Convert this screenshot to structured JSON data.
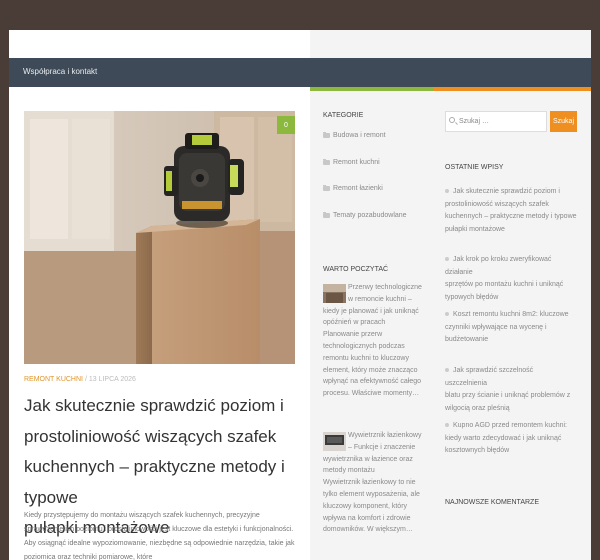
{
  "nav": {
    "item": "Współpraca i kontakt"
  },
  "post": {
    "category": "REMONT KUCHNI",
    "date": "13 LIPCA 2026",
    "comments": "0",
    "title_lines": [
      "Jak skutecznie sprawdzić poziom i",
      "prostoliniowość wiszących szafek",
      "kuchennych – praktyczne metody i typowe",
      "pułapki montażowe"
    ],
    "excerpt_lines": [
      "Kiedy przystępujemy do montażu wiszących szafek kuchennych, precyzyjne",
      "sprawdzenie ich poziomu i prostoliniowości jest kluczowe dla estetyki i funkcjonalności.",
      "Aby osiągnąć idealne wypoziomowanie, niezbędne są odpowiednie narzędzia, takie jak",
      "poziomica oraz techniki pomiarowe, które"
    ]
  },
  "categories": {
    "title": "KATEGORIE",
    "items": [
      "Budowa i remont",
      "Remont kuchni",
      "Remont łazienki",
      "Tematy pozabudowlane"
    ]
  },
  "worth_reading": {
    "title": "WARTO POCZYTAĆ",
    "item1_lines": [
      "Przerwy technologiczne",
      "w remoncie kuchni –",
      "kiedy je planować i jak uniknąć",
      "opóźnień w pracach",
      "Planowanie przerw",
      "technologicznych podczas",
      "remontu kuchni to kluczowy",
      "element, który może znacząco",
      "wpłynąć na efektywność całego",
      "procesu. Właściwe momenty…"
    ],
    "item2_lines": [
      "Wywietrznik łazienkowy",
      "– Funkcje i znaczenie",
      "wywietrznika w łazience oraz",
      "metody montażu",
      "Wywietrznik łazienkowy to nie",
      "tylko element wyposażenia, ale",
      "kluczowy komponent, który",
      "wpływa na komfort i zdrowie",
      "domowników. W większym…"
    ]
  },
  "search": {
    "placeholder": "Szukaj …",
    "button": "Szukaj"
  },
  "recent_posts": {
    "title": "OSTATNIE WPISY",
    "items": [
      [
        "Jak skutecznie sprawdzić poziom i",
        "prostoliniowość wiszących szafek",
        "kuchennych – praktyczne metody i typowe",
        "pułapki montażowe"
      ],
      [
        "Jak krok po kroku zweryfikować działanie",
        "sprzętów po montażu kuchni i uniknąć",
        "typowych błędów"
      ],
      [
        "Koszt remontu kuchni 8m2: kluczowe",
        "czynniki wpływające na wycenę i",
        "budżetowanie"
      ],
      [
        "Jak sprawdzić szczelność uszczelnienia",
        "blatu przy ścianie i uniknąć problemów z",
        "wilgocią oraz pleśnią"
      ],
      [
        "Kupno AGD przed remontem kuchni:",
        "kiedy warto zdecydować i jak uniknąć",
        "kosztownych błędów"
      ]
    ]
  },
  "latest_comments": {
    "title": "NAJNOWSZE KOMENTARZE"
  },
  "colors": {
    "accent_orange": "#ef8f1f",
    "accent_green": "#8cb93d",
    "nav_bg": "#3e4a57",
    "header_bg": "#4a3c36"
  }
}
